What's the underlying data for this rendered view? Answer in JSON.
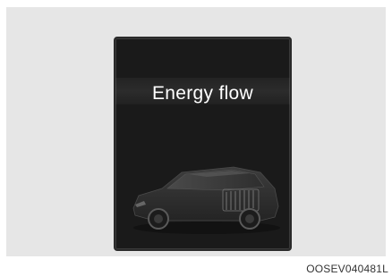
{
  "screen": {
    "title": "Energy flow",
    "car_icon": "car-icon"
  },
  "caption": {
    "code": "OOSEV040481L"
  },
  "colors": {
    "panel_background": "#e6e6e6",
    "screen_background": "#1a1a1a",
    "title_text": "#ffffff"
  }
}
